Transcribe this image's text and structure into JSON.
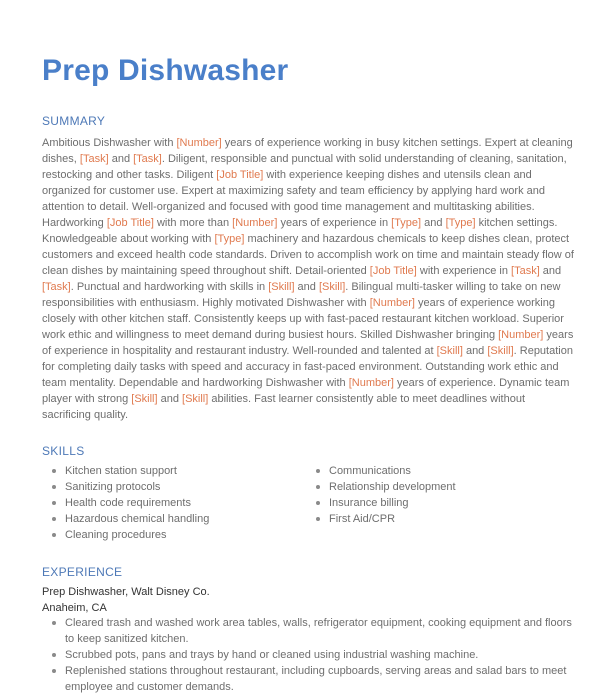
{
  "document": {
    "title": "Prep Dishwasher"
  },
  "summary": {
    "heading": "SUMMARY",
    "segments": [
      {
        "t": "Ambitious Dishwasher with "
      },
      {
        "t": "[Number]",
        "ph": true
      },
      {
        "t": " years of experience working in busy kitchen settings. Expert at cleaning dishes, "
      },
      {
        "t": "[Task]",
        "ph": true
      },
      {
        "t": " and "
      },
      {
        "t": "[Task]",
        "ph": true
      },
      {
        "t": ". Diligent, responsible and punctual with solid understanding of cleaning, sanitation, restocking and other tasks. Diligent "
      },
      {
        "t": "[Job Title]",
        "ph": true
      },
      {
        "t": " with experience keeping dishes and utensils clean and organized for customer use. Expert at maximizing safety and team efficiency by applying hard work and attention to detail. Well-organized and focused with good time management and multitasking abilities. Hardworking "
      },
      {
        "t": "[Job Title]",
        "ph": true
      },
      {
        "t": " with more than "
      },
      {
        "t": "[Number]",
        "ph": true
      },
      {
        "t": " years of experience in "
      },
      {
        "t": "[Type]",
        "ph": true
      },
      {
        "t": " and "
      },
      {
        "t": "[Type]",
        "ph": true
      },
      {
        "t": " kitchen settings. Knowledgeable about working with "
      },
      {
        "t": "[Type]",
        "ph": true
      },
      {
        "t": " machinery and hazardous chemicals to keep dishes clean, protect customers and exceed health code standards. Driven to accomplish work on time and maintain steady flow of clean dishes by maintaining speed throughout shift. Detail-oriented "
      },
      {
        "t": "[Job Title]",
        "ph": true
      },
      {
        "t": " with experience in "
      },
      {
        "t": "[Task]",
        "ph": true
      },
      {
        "t": " and "
      },
      {
        "t": "[Task]",
        "ph": true
      },
      {
        "t": ". Punctual and hardworking with skills in "
      },
      {
        "t": "[Skill]",
        "ph": true
      },
      {
        "t": " and "
      },
      {
        "t": "[Skill]",
        "ph": true
      },
      {
        "t": ". Bilingual multi-tasker willing to take on new responsibilities with enthusiasm. Highly motivated Dishwasher with "
      },
      {
        "t": "[Number]",
        "ph": true
      },
      {
        "t": " years of experience working closely with other kitchen staff. Consistently keeps up with fast-paced restaurant kitchen workload. Superior work ethic and willingness to meet demand during busiest hours. Skilled Dishwasher bringing "
      },
      {
        "t": "[Number]",
        "ph": true
      },
      {
        "t": " years of experience in hospitality and restaurant industry. Well-rounded and talented at "
      },
      {
        "t": "[Skill]",
        "ph": true
      },
      {
        "t": " and "
      },
      {
        "t": "[Skill]",
        "ph": true
      },
      {
        "t": ". Reputation for completing daily tasks with speed and accuracy in fast-paced environment. Outstanding work ethic and team mentality. Dependable and hardworking Dishwasher with "
      },
      {
        "t": "[Number]",
        "ph": true
      },
      {
        "t": " years of experience. Dynamic team player with strong "
      },
      {
        "t": "[Skill]",
        "ph": true
      },
      {
        "t": " and "
      },
      {
        "t": "[Skill]",
        "ph": true
      },
      {
        "t": " abilities. Fast learner consistently able to meet deadlines without sacrificing quality."
      }
    ]
  },
  "skills": {
    "heading": "SKILLS",
    "left": [
      "Kitchen station support",
      "Sanitizing protocols",
      "Health code requirements",
      "Hazardous chemical handling",
      "Cleaning procedures"
    ],
    "right": [
      "Communications",
      "Relationship development",
      "Insurance billing",
      "First Aid/CPR"
    ]
  },
  "experience": {
    "heading": "EXPERIENCE",
    "jobs": [
      {
        "title_company": "Prep Dishwasher, Walt Disney Co.",
        "location": "Anaheim, CA",
        "bullets": [
          "Cleared trash and washed work area tables, walls, refrigerator equipment, cooking equipment and floors to keep sanitized kitchen.",
          "Scrubbed pots, pans and trays by hand or cleaned using industrial washing machine.",
          "Replenished stations throughout restaurant, including cupboards, serving areas and salad bars to meet employee and customer demands."
        ]
      }
    ]
  },
  "colors": {
    "title": "#4a7fc9",
    "heading": "#4e79b7",
    "body_text": "#6e6e6e",
    "placeholder": "#e07a4f"
  }
}
